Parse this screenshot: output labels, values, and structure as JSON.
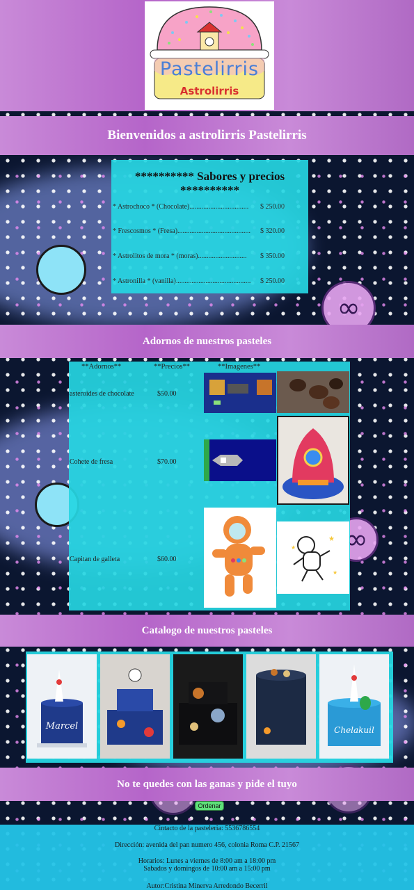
{
  "logo": {
    "title": "Pastelirris",
    "subtitle": "Astrolirris"
  },
  "header": {
    "welcome": "Bienvenidos a astrolirris Pastelirris"
  },
  "menu": {
    "title": "********** Sabores y precios **********",
    "items": [
      {
        "name": "* Astrochoco * (Chocolate)",
        "dots": "..................................",
        "price": "$ 250.00"
      },
      {
        "name": "* Frescosmos * (Fresa)",
        "dots": "..........................................",
        "price": "$ 320.00"
      },
      {
        "name": "* Astrolitos de mora * (moras)",
        "dots": "............................",
        "price": "$ 350.00"
      },
      {
        "name": "* Astronilla * (vanilla)",
        "dots": "...........................................",
        "price": "$ 250.00"
      }
    ]
  },
  "ornaments": {
    "title": "Adornos de nuestros pasteles",
    "headers": [
      "**Adornos**",
      "**Precios**",
      "**Imagenes**"
    ],
    "rows": [
      {
        "name": "asteroides de chocolate",
        "price": "$50.00"
      },
      {
        "name": "Cohete de fresa",
        "price": "$70.00"
      },
      {
        "name": "Capitan de galleta",
        "price": "$60.00"
      }
    ]
  },
  "catalog": {
    "title": "Catalogo de nuestros pasteles",
    "cakes": [
      {
        "label": "Marcel"
      },
      {
        "label": ""
      },
      {
        "label": ""
      },
      {
        "label": ""
      },
      {
        "label": "Chelakuil"
      }
    ]
  },
  "cta": {
    "text": "No te quedes con las ganas y pide el tuyo",
    "button": "Ordenar"
  },
  "footer": {
    "contact": "Cintacto de la pasteleria: 5536786554",
    "address": "Dirección: avenida del pan numero 456, colonia Roma C.P. 21567",
    "hours1": "Horarios: Lunes a viernes de 8:00 am a 18:00 pm",
    "hours2": "Sabados y domingos de 10:00 am a 15:00 pm",
    "author": "Autor:Cristina Minerva Arredondo Becerril"
  },
  "colors": {
    "band": "#c98ad8",
    "panel": "#26d6e2",
    "footer": "#24c4e8",
    "button": "#5ee07a"
  }
}
